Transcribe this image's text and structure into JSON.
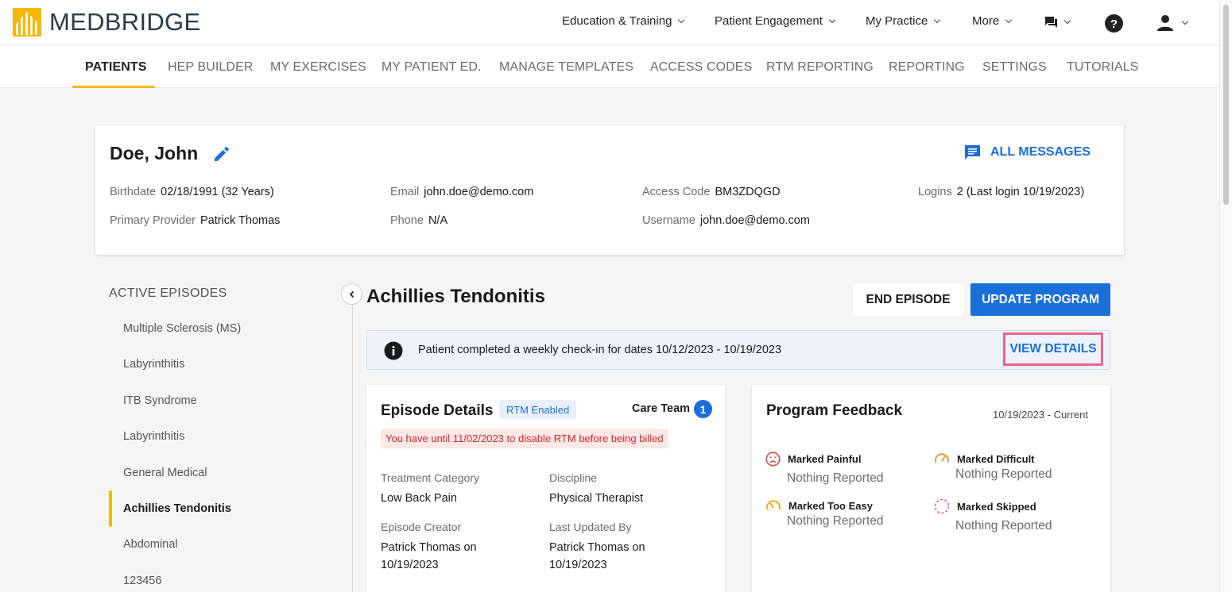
{
  "brand": {
    "name": "MEDBRIDGE",
    "accent": "#f5b800",
    "primary": "#1a6fd8"
  },
  "topnav": {
    "items": [
      {
        "label": "Education & Training"
      },
      {
        "label": "Patient Engagement"
      },
      {
        "label": "My Practice"
      },
      {
        "label": "More"
      }
    ],
    "icons": [
      "messages-icon",
      "help-icon",
      "user-icon"
    ]
  },
  "subnav": {
    "items": [
      "PATIENTS",
      "HEP BUILDER",
      "MY EXERCISES",
      "MY PATIENT ED.",
      "MANAGE TEMPLATES",
      "ACCESS CODES",
      "RTM REPORTING",
      "REPORTING",
      "SETTINGS",
      "TUTORIALS"
    ],
    "active": "PATIENTS"
  },
  "patient": {
    "name": "Doe, John",
    "all_messages": "ALL MESSAGES",
    "birthdate_label": "Birthdate",
    "birthdate": "02/18/1991 (32 Years)",
    "provider_label": "Primary Provider",
    "provider": "Patrick Thomas",
    "email_label": "Email",
    "email": "john.doe@demo.com",
    "phone_label": "Phone",
    "phone": "N/A",
    "access_label": "Access Code",
    "access": "BM3ZDQGD",
    "username_label": "Username",
    "username": "john.doe@demo.com",
    "logins_label": "Logins",
    "logins": "2 (Last login 10/19/2023)"
  },
  "episodes": {
    "heading": "ACTIVE EPISODES",
    "items": [
      "Multiple Sclerosis (MS)",
      "Labyrinthitis",
      "ITB Syndrome",
      "Labyrinthitis",
      "General Medical",
      "Achillies Tendonitis",
      "Abdominal",
      "123456"
    ],
    "active": "Achillies Tendonitis"
  },
  "main": {
    "title": "Achillies Tendonitis",
    "end_episode": "END EPISODE",
    "update_program": "UPDATE PROGRAM",
    "banner_text": "Patient completed a weekly check-in for dates 10/12/2023 - 10/19/2023",
    "view_details": "VIEW DETAILS"
  },
  "episode_details": {
    "title": "Episode Details",
    "rtm_badge": "RTM Enabled",
    "care_team": "Care Team",
    "care_count": "1",
    "warning": "You have until 11/02/2023 to disable RTM before being billed",
    "treatment_label": "Treatment Category",
    "treatment": "Low Back Pain",
    "discipline_label": "Discipline",
    "discipline": "Physical Therapist",
    "creator_label": "Episode Creator",
    "creator_l1": "Patrick Thomas on",
    "creator_l2": "10/19/2023",
    "updated_label": "Last Updated By",
    "updated_l1": "Patrick Thomas on",
    "updated_l2": "10/19/2023"
  },
  "feedback": {
    "title": "Program Feedback",
    "range": "10/19/2023 - Current",
    "painful": "Marked Painful",
    "painful_val": "Nothing Reported",
    "difficult": "Marked Difficult",
    "difficult_val": "Nothing Reported",
    "easy": "Marked Too Easy",
    "easy_val": "Nothing Reported",
    "skipped": "Marked Skipped",
    "skipped_val": "Nothing Reported"
  }
}
